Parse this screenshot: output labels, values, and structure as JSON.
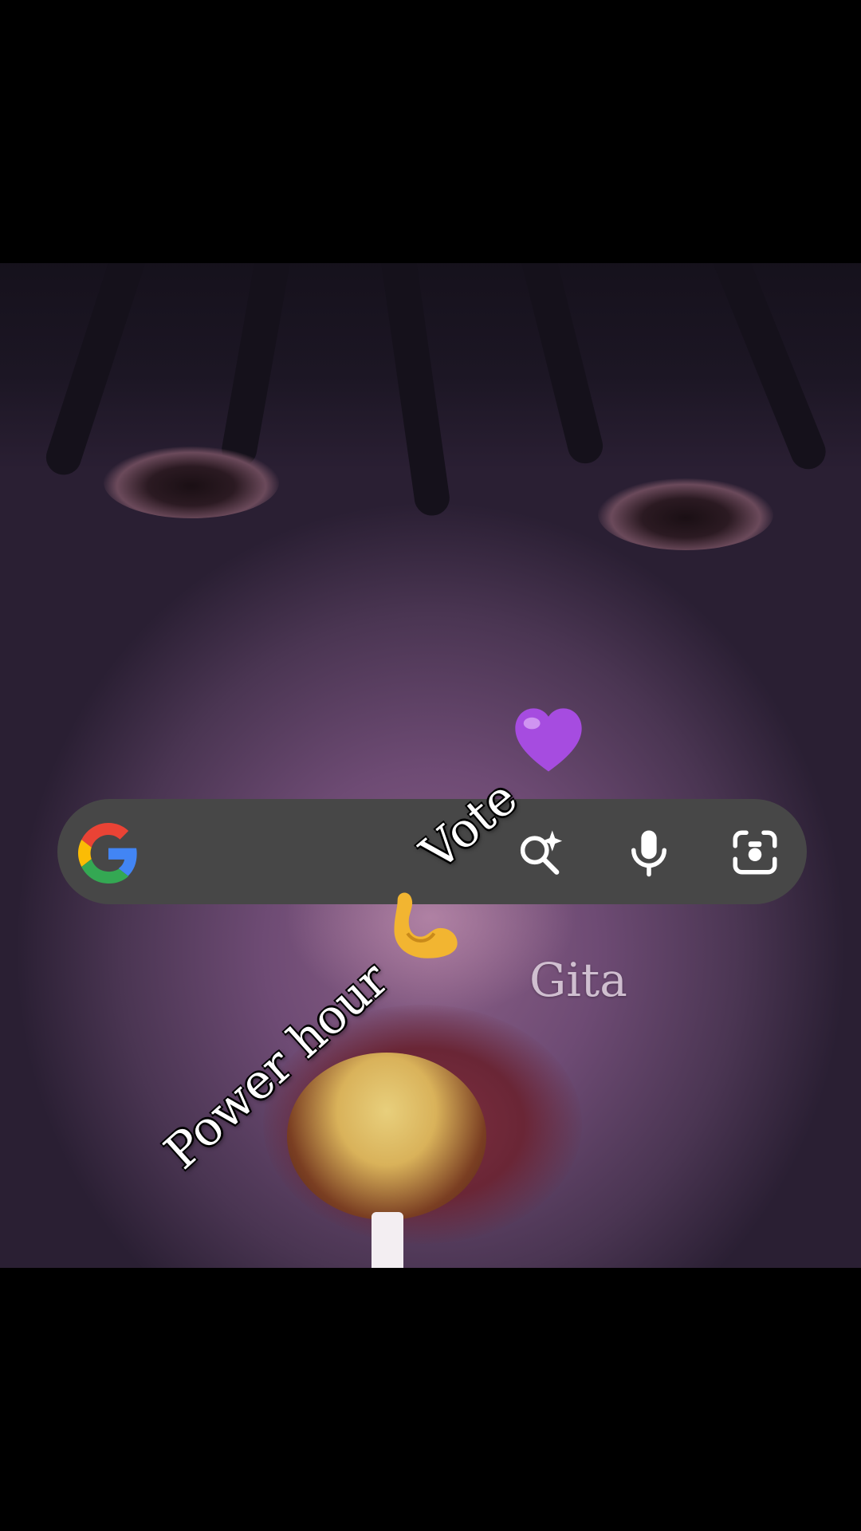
{
  "overlay": {
    "vote": "Vote",
    "power_hour": "Power  hour",
    "watermark": "Gita"
  },
  "search_bar": {
    "logo": "google-g-logo",
    "icons": [
      "ai-search-icon",
      "mic-icon",
      "camera-lens-icon"
    ]
  },
  "stickers": [
    "purple-heart-icon",
    "flexed-biceps-icon"
  ],
  "colors": {
    "background": "#000000",
    "search_bar": "#474747",
    "heart": "#a64ce0",
    "biceps": "#f2b531",
    "text": "#ffffff"
  }
}
